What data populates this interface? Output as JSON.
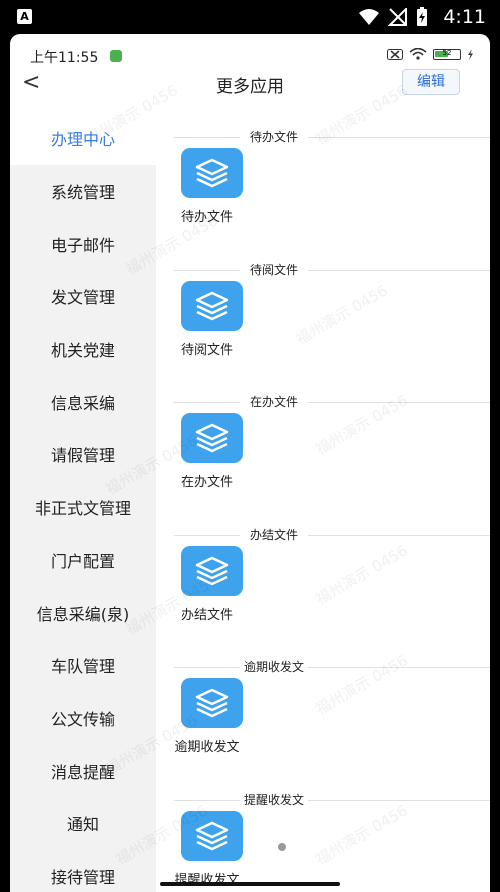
{
  "system_bar": {
    "time": "4:11",
    "notification_letter": "A"
  },
  "app_status": {
    "time": "上午11:55",
    "battery": "52"
  },
  "nav": {
    "back_glyph": "<",
    "title": "更多应用",
    "edit_label": "编辑"
  },
  "sidebar": {
    "items": [
      {
        "label": "办理中心"
      },
      {
        "label": "系统管理"
      },
      {
        "label": "电子邮件"
      },
      {
        "label": "发文管理"
      },
      {
        "label": "机关党建"
      },
      {
        "label": "信息采编"
      },
      {
        "label": "请假管理"
      },
      {
        "label": "非正式文管理"
      },
      {
        "label": "门户配置"
      },
      {
        "label": "信息采编(泉)"
      },
      {
        "label": "车队管理"
      },
      {
        "label": "公文传输"
      },
      {
        "label": "消息提醒"
      },
      {
        "label": "通知"
      },
      {
        "label": "接待管理"
      }
    ],
    "active_index": 0
  },
  "sections": [
    {
      "title": "待办文件",
      "tile": "待办文件"
    },
    {
      "title": "待阅文件",
      "tile": "待阅文件"
    },
    {
      "title": "在办文件",
      "tile": "在办文件"
    },
    {
      "title": "办结文件",
      "tile": "办结文件"
    },
    {
      "title": "逾期收发文",
      "tile": "逾期收发文"
    },
    {
      "title": "提醒收发文",
      "tile": "提醒收发文"
    }
  ],
  "watermark_text": "福州演示 0456",
  "colors": {
    "accent": "#3a7ee6",
    "tile_icon_bg": "#3ea3ec",
    "sidebar_bg": "#f2f2f2"
  },
  "icons": {
    "tile_icon": "layers-icon",
    "back_icon": "chevron-left-icon"
  }
}
